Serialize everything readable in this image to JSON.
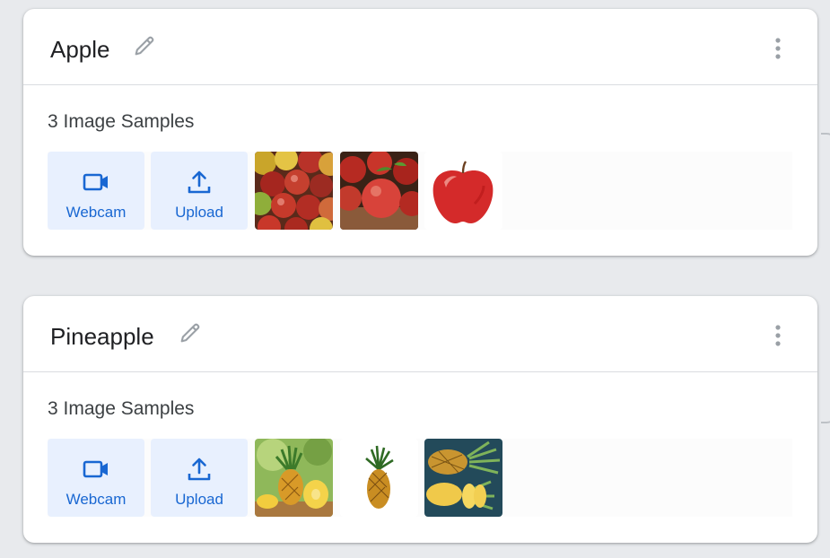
{
  "classes": [
    {
      "name": "Apple",
      "sample_count": "3 Image Samples",
      "buttons": {
        "webcam": "Webcam",
        "upload": "Upload"
      },
      "samples": [
        "apple-pile-photo",
        "red-apples-photo",
        "single-red-apple-photo"
      ]
    },
    {
      "name": "Pineapple",
      "sample_count": "3 Image Samples",
      "buttons": {
        "webcam": "Webcam",
        "upload": "Upload"
      },
      "samples": [
        "sliced-pineapple-photo",
        "whole-pineapple-photo",
        "pineapple-halves-photo"
      ]
    }
  ],
  "colors": {
    "accent": "#1967d2",
    "button_bg": "#e8f0fe",
    "background": "#e8eaed"
  },
  "icons": [
    "edit-icon",
    "more-vert-icon",
    "webcam-icon",
    "upload-icon"
  ]
}
